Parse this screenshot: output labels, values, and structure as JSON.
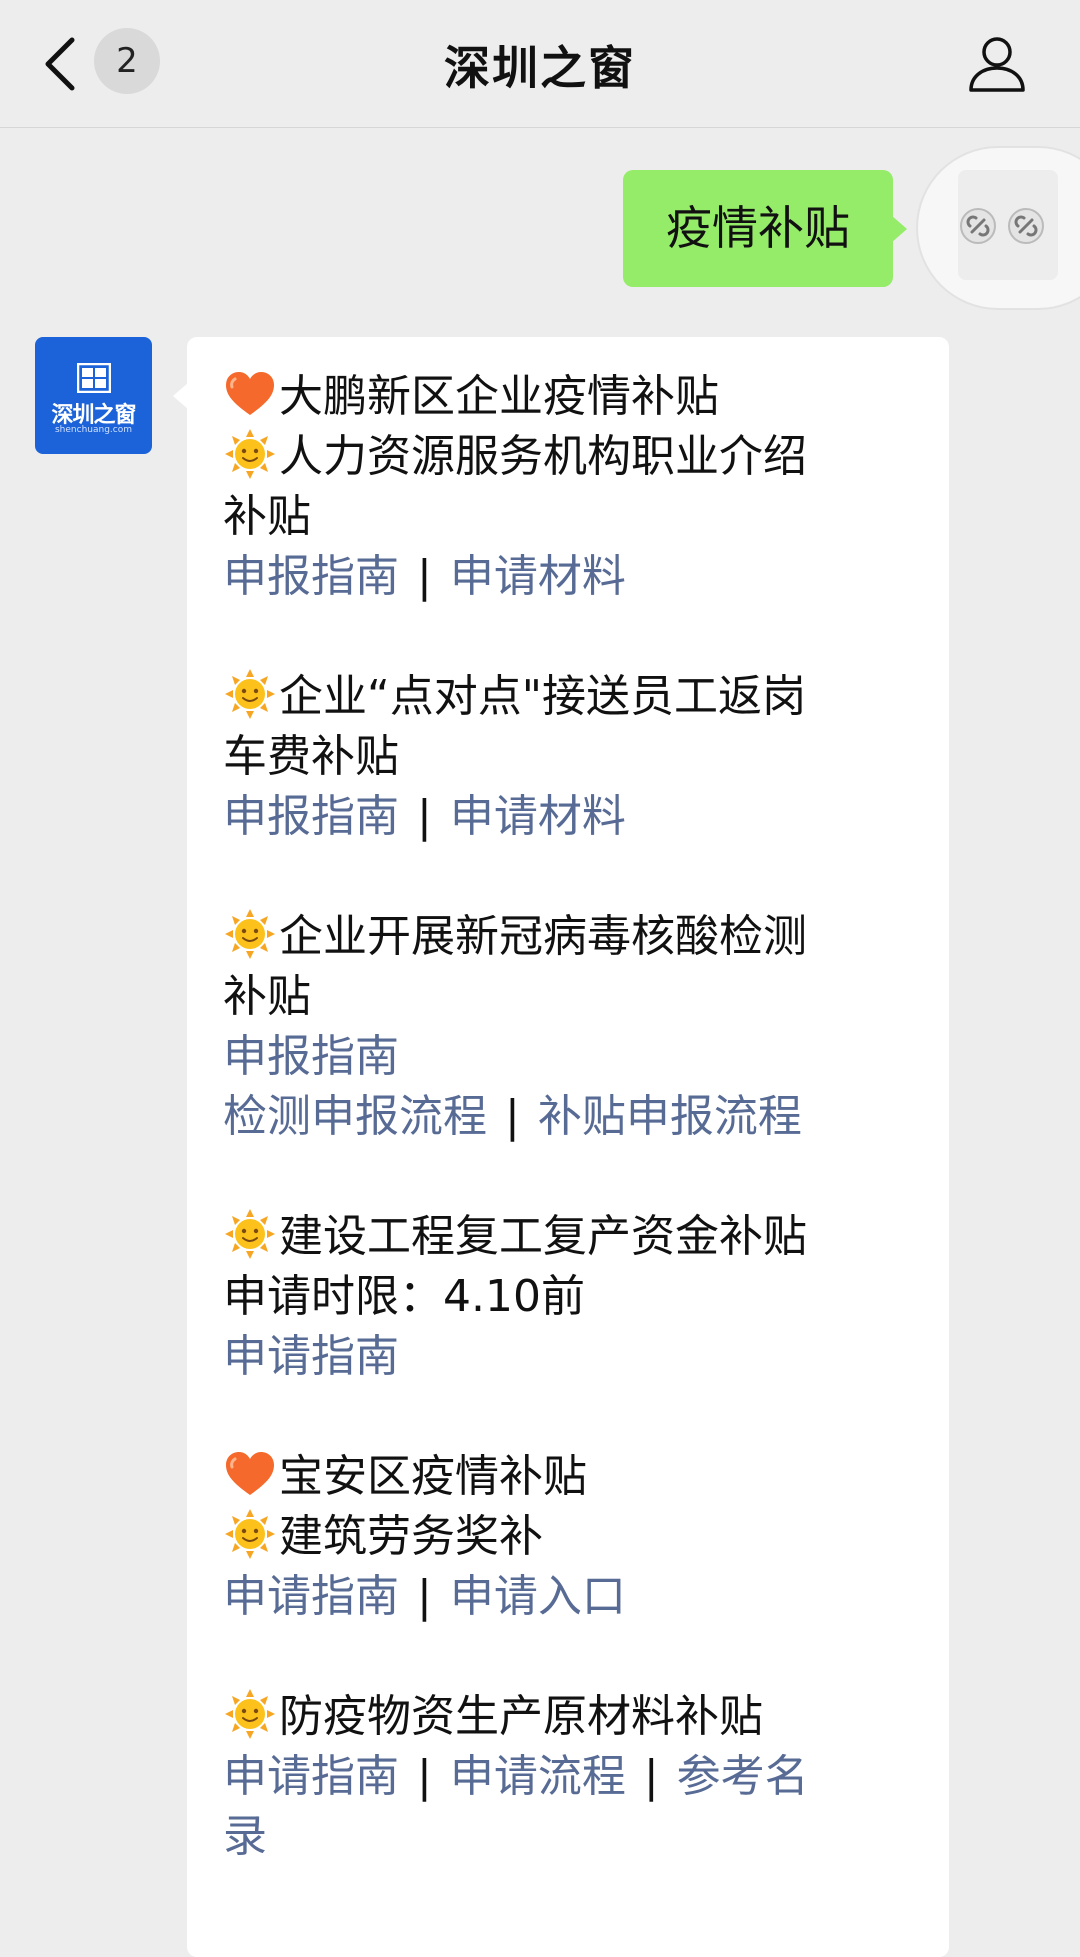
{
  "header": {
    "unread_count": "2",
    "title": "深圳之窗"
  },
  "outgoing": {
    "text": "疫情补贴"
  },
  "avatar": {
    "brand": "深圳之窗",
    "domain": "shenchuang.com"
  },
  "message": {
    "s1": {
      "heading": "大鹏新区企业疫情补贴",
      "item_a": "人力资源服务机构职业介绍",
      "item_a_cont": "补贴",
      "link_guide": "申报指南",
      "link_materials": "申请材料"
    },
    "s2": {
      "item_a": "企业“点对点\"接送员工返岗",
      "item_a_cont": "车费补贴",
      "link_guide": "申报指南",
      "link_materials": "申请材料"
    },
    "s3": {
      "item_a": "企业开展新冠病毒核酸检测",
      "item_a_cont": "补贴",
      "link_guide": "申报指南",
      "link_test_flow": "检测申报流程",
      "link_subsidy_flow": "补贴申报流程"
    },
    "s4": {
      "item_a": "建设工程复工复产资金补贴",
      "deadline": "申请时限：4.10前",
      "link_guide": "申请指南"
    },
    "s5": {
      "heading": "宝安区疫情补贴",
      "item_a": "建筑劳务奖补",
      "link_guide": "申请指南",
      "link_entry": "申请入口"
    },
    "s6": {
      "item_a": "防疫物资生产原材料补贴",
      "link_guide": "申请指南",
      "link_flow": "申请流程",
      "link_list": "参考名",
      "link_list_cont": "录"
    },
    "separator": "|"
  },
  "icons": {
    "heart": "orange-heart-icon",
    "sun": "sun-with-face-icon"
  }
}
